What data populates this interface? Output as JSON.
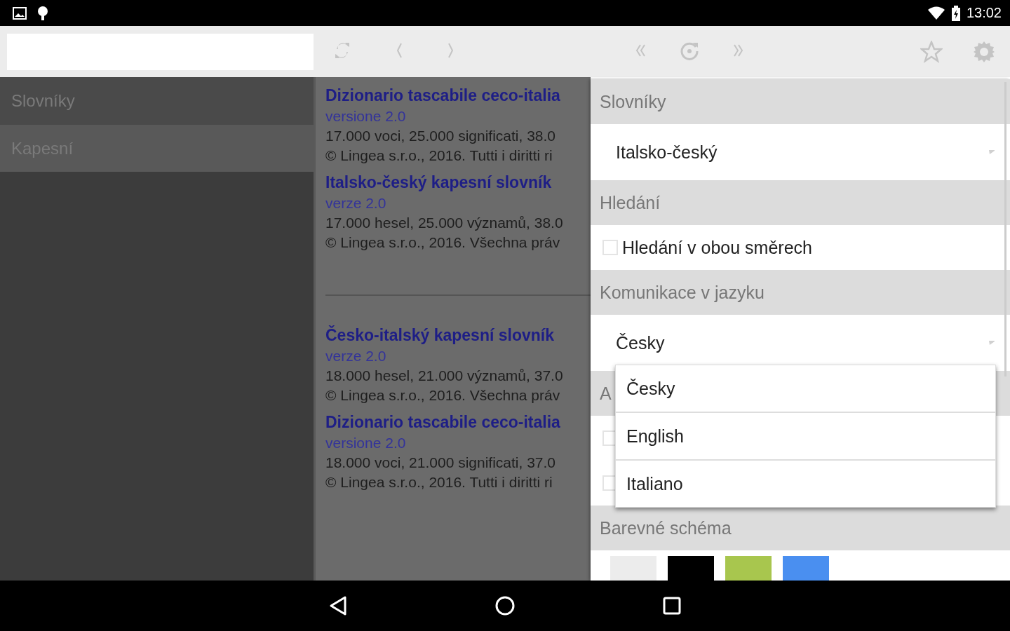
{
  "status_bar": {
    "time": "13:02"
  },
  "toolbar": {
    "buttons": [
      {
        "kind": "sync"
      },
      {
        "kind": "prev"
      },
      {
        "kind": "next"
      },
      {
        "kind": "first"
      },
      {
        "kind": "refresh"
      },
      {
        "kind": "last"
      },
      {
        "kind": "star"
      },
      {
        "kind": "settings"
      }
    ]
  },
  "sidebar": {
    "header": "Slovníky",
    "items": [
      {
        "label": "Kapesní",
        "selected": true
      }
    ]
  },
  "dictionaries": {
    "groups": [
      {
        "entries": [
          {
            "title": "Dizionario tascabile ceco-italia",
            "version": "versione 2.0",
            "stats": "17.000 voci, 25.000 significati, 38.0",
            "copyright": "© Lingea s.r.o., 2016. Tutti i diritti ri"
          },
          {
            "title": "Italsko-český kapesní slovník",
            "version": "verze 2.0",
            "stats": "17.000 hesel, 25.000 významů, 38.0",
            "copyright": "© Lingea s.r.o., 2016. Všechna práv"
          }
        ]
      },
      {
        "entries": [
          {
            "title": "Česko-italský kapesní slovník",
            "version": "verze 2.0",
            "stats": "18.000 hesel, 21.000 významů, 37.0",
            "copyright": "© Lingea s.r.o., 2016. Všechna práv"
          },
          {
            "title": "Dizionario tascabile ceco-italia",
            "version": "versione 2.0",
            "stats": "18.000 voci, 21.000 significati, 37.0",
            "copyright": "© Lingea s.r.o., 2016. Tutti i diritti ri"
          }
        ]
      }
    ]
  },
  "settings": {
    "sections": [
      {
        "title": "Slovníky",
        "items": [
          {
            "kind": "spinner",
            "value": "Italsko-český"
          }
        ]
      },
      {
        "title": "Hledání",
        "items": [
          {
            "kind": "checkbox",
            "label": "Hledání v obou směrech",
            "checked": false
          }
        ]
      },
      {
        "title": "Komunikace v jazyku",
        "items": [
          {
            "kind": "spinner",
            "value": "Česky"
          }
        ]
      },
      {
        "title": "A",
        "items": [
          {
            "kind": "checkbox",
            "checked": false
          },
          {
            "kind": "checkbox",
            "checked": false
          }
        ]
      },
      {
        "title": "Barevné schéma",
        "items": [
          {
            "kind": "swatches",
            "colors": [
              {
                "color": "#ececec"
              },
              {
                "color": "#000000"
              },
              {
                "color": "#a8c64e"
              },
              {
                "color": "#4a8ff0"
              }
            ]
          }
        ]
      }
    ]
  },
  "dropdown": {
    "options": [
      {
        "label": "Česky"
      },
      {
        "label": "English"
      },
      {
        "label": "Italiano"
      }
    ]
  }
}
